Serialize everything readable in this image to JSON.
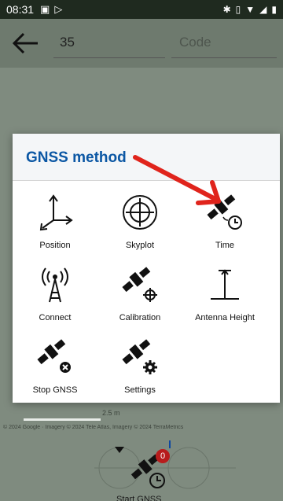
{
  "status_bar": {
    "time": "08:31"
  },
  "toolbar": {
    "point_name": "35",
    "code_placeholder": "Code"
  },
  "map": {
    "scale_label": "2.5 m",
    "attribution": "© 2024 Google · Imagery © 2024 Tele Atlas, Imagery © 2024 TerraMetrics"
  },
  "dialog": {
    "title": "GNSS method",
    "items": [
      {
        "label": "Position",
        "icon": "axes-icon"
      },
      {
        "label": "Skyplot",
        "icon": "crosshair-circle-icon"
      },
      {
        "label": "Time",
        "icon": "satellite-clock-icon"
      },
      {
        "label": "Connect",
        "icon": "antenna-signal-icon"
      },
      {
        "label": "Calibration",
        "icon": "satellite-target-icon"
      },
      {
        "label": "Antenna Height",
        "icon": "antenna-height-icon"
      },
      {
        "label": "Stop GNSS",
        "icon": "satellite-stop-icon"
      },
      {
        "label": "Settings",
        "icon": "satellite-gear-icon"
      }
    ]
  },
  "bottom": {
    "start_gnss_label": "Start GNSS",
    "badge_count": "0"
  },
  "colors": {
    "title_blue": "#0b57a4",
    "arrow_red": "#e0241c",
    "badge_red": "#b71c1c"
  }
}
